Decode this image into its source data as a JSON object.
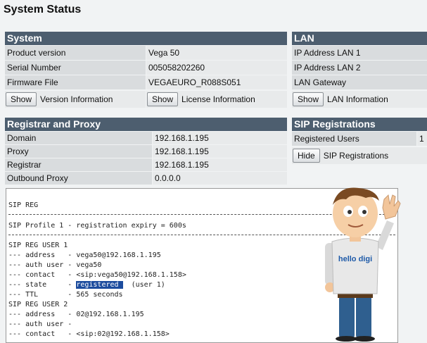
{
  "page": {
    "title": "System Status"
  },
  "system": {
    "header": "System",
    "rows": [
      {
        "label": "Product version",
        "value": "Vega 50"
      },
      {
        "label": "Serial Number",
        "value": "005058202260"
      },
      {
        "label": "Firmware File",
        "value": "VEGAEURO_R088S051"
      }
    ],
    "show_version_button": "Show",
    "show_version_label": "Version Information",
    "show_license_button": "Show",
    "show_license_label": "License Information"
  },
  "lan": {
    "header": "LAN",
    "rows": [
      {
        "label": "IP Address LAN 1"
      },
      {
        "label": "IP Address LAN 2"
      },
      {
        "label": "LAN Gateway"
      }
    ],
    "show_button": "Show",
    "show_label": "LAN Information"
  },
  "registrar": {
    "header": "Registrar and Proxy",
    "rows": [
      {
        "label": "Domain",
        "value": "192.168.1.195"
      },
      {
        "label": "Proxy",
        "value": "192.168.1.195"
      },
      {
        "label": "Registrar",
        "value": "192.168.1.195"
      },
      {
        "label": "Outbound Proxy",
        "value": "0.0.0.0"
      }
    ]
  },
  "sip_registrations": {
    "header": "SIP Registrations",
    "registered_label": "Registered Users",
    "registered_value": "1",
    "hide_button": "Hide",
    "hide_label": "SIP Registrations"
  },
  "console": {
    "title": "SIP REG",
    "profile": "SIP Profile 1 - registration expiry = 600s",
    "user1_header": "SIP REG USER 1",
    "user1_address": "--- address   - vega50@192.168.1.195",
    "user1_auth": "--- auth user - vega50",
    "user1_contact": "--- contact   - <sip:vega50@192.168.1.158>",
    "user1_state_prefix": "--- state     - ",
    "user1_state_value": "registered ",
    "user1_state_suffix": "  (user 1)",
    "user1_ttl": "--- TTL       - 565 seconds",
    "user2_header": "SIP REG USER 2",
    "user2_address": "--- address   - 02@192.168.1.195",
    "user2_auth": "--- auth user -",
    "user2_contact": "--- contact   - <sip:02@192.168.1.158>"
  },
  "mascot": {
    "shirt_text": "hello digi"
  }
}
